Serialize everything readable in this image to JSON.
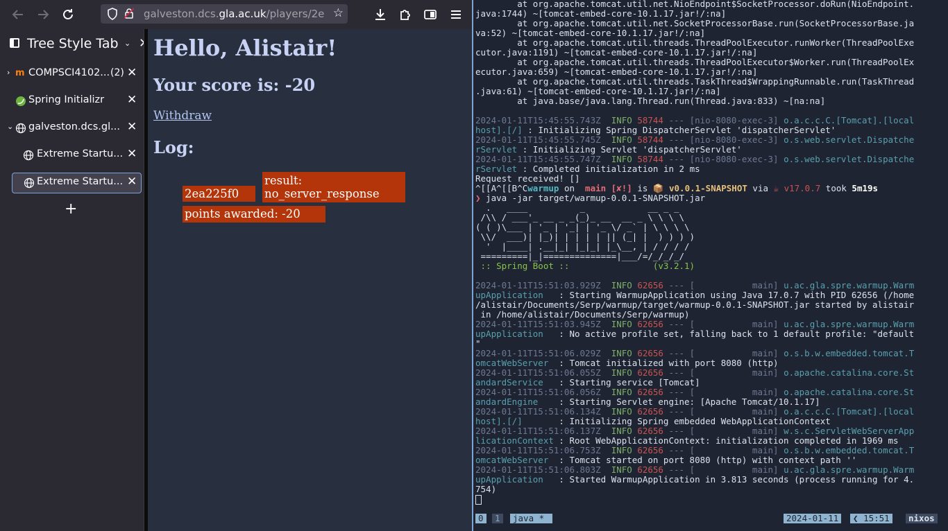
{
  "browser": {
    "url_prefix": "galveston.dcs.",
    "url_domain": "gla.ac.uk",
    "url_suffix": "/players/2e",
    "sidebar_title": "Tree Style Tab",
    "tabs": [
      {
        "label": "COMPSCI4102...",
        "count": "(2)",
        "icon": "moodle-icon",
        "expanded": false
      },
      {
        "label": "Spring Initializr",
        "icon": "spring-icon"
      },
      {
        "label": "galveston.dcs.gl...",
        "icon": "globe-icon",
        "expanded": true
      },
      {
        "label": "Extreme Startu...",
        "icon": "globe-icon"
      },
      {
        "label": "Extreme Startu...",
        "icon": "globe-icon",
        "active": true
      }
    ]
  },
  "page": {
    "greeting": "Hello, Alistair!",
    "score": "Your score is: -20",
    "withdraw": "Withdraw",
    "log_title": "Log:",
    "log": {
      "id": "2ea225f0",
      "result_label": "result:",
      "result_value": "no_server_response",
      "points": "points awarded: -20"
    }
  },
  "terminal": {
    "trace": [
      "        at org.apache.tomcat.util.net.NioEndpoint$SocketProcessor.doRun(NioEndpoint.",
      "java:1744) ~[tomcat-embed-core-10.1.17.jar!/:na]",
      "        at org.apache.tomcat.util.net.SocketProcessorBase.run(SocketProcessorBase.ja",
      "va:52) ~[tomcat-embed-core-10.1.17.jar!/:na]",
      "        at org.apache.tomcat.util.threads.ThreadPoolExecutor.runWorker(ThreadPoolExe",
      "cutor.java:1191) ~[tomcat-embed-core-10.1.17.jar!/:na]",
      "        at org.apache.tomcat.util.threads.ThreadPoolExecutor$Worker.run(ThreadPoolEx",
      "ecutor.java:659) ~[tomcat-embed-core-10.1.17.jar!/:na]",
      "        at org.apache.tomcat.util.threads.TaskThread$WrappingRunnable.run(TaskThread",
      ".java:61) ~[tomcat-embed-core-10.1.17.jar!/:na]",
      "        at java.base/java.lang.Thread.run(Thread.java:833) ~[na:na]"
    ],
    "log_a": [
      {
        "ts": "2024-01-11T15:45:55.743Z",
        "pid": "58744",
        "thread": "[nio-8080-exec-3]",
        "cls1": "o.a.c.c.C.[Tomcat].[local",
        "cls2": "host].[/]",
        "msg": "Initializing Spring DispatcherServlet 'dispatcherServlet'"
      },
      {
        "ts": "2024-01-11T15:45:55.745Z",
        "pid": "58744",
        "thread": "[nio-8080-exec-3]",
        "cls1": "o.s.web.servlet.Dispatche",
        "cls2": "rServlet",
        "msg": "Initializing Servlet 'dispatcherServlet'"
      },
      {
        "ts": "2024-01-11T15:45:55.747Z",
        "pid": "58744",
        "thread": "[nio-8080-exec-3]",
        "cls1": "o.s.web.servlet.Dispatche",
        "cls2": "rServlet",
        "msg": "Completed initialization in 2 ms"
      }
    ],
    "request_line": "Request received! []",
    "prompt": {
      "prefix": "^[[A^[[B^C",
      "dir": "warmup",
      "on": " on ",
      "branch": " main [✘!]",
      "is": " is ",
      "version": "📦 v0.0.1-SNAPSHOT",
      "via": " via ",
      "java": "☕ v17.0.7",
      "took": " took ",
      "time": "5m19s"
    },
    "command": "❯ java -jar target/warmup-0.0.1-SNAPSHOT.jar",
    "banner": [
      "",
      "  .   ____          _            __ _ _",
      " /\\\\ / ___'_ __ _ _(_)_ __  __ _ \\ \\ \\ \\",
      "( ( )\\___ | '_ | '_| | '_ \\/ _` | \\ \\ \\ \\",
      " \\\\/  ___)| |_)| | | | | || (_| |  ) ) ) )",
      "  '  |____| .__|_| |_|_| |_\\__, | / / / /",
      " =========|_|==============|___/=/_/_/_/"
    ],
    "spring_boot": " :: Spring Boot ::                (v3.2.1)",
    "log_b": [
      {
        "ts": "2024-01-11T15:51:03.929Z",
        "pid": "62656",
        "thread": "[           main]",
        "cls1": "u.ac.gla.spre.warmup.Warm",
        "cls2": "upApplication  ",
        "msg": "Starting WarmupApplication using Java 17.0.7 with PID 62656 (/home",
        "more": [
          "/alistair/Documents/Serp/warmup/target/warmup-0.0.1-SNAPSHOT.jar started by alistair",
          " in /home/alistair/Documents/Serp/warmup)"
        ]
      },
      {
        "ts": "2024-01-11T15:51:03.945Z",
        "pid": "62656",
        "thread": "[           main]",
        "cls1": "u.ac.gla.spre.warmup.Warm",
        "cls2": "upApplication  ",
        "msg": "No active profile set, falling back to 1 default profile: \"default",
        "more": [
          "\""
        ]
      },
      {
        "ts": "2024-01-11T15:51:06.029Z",
        "pid": "62656",
        "thread": "[           main]",
        "cls1": "o.s.b.w.embedded.tomcat.T",
        "cls2": "omcatWebServer ",
        "msg": "Tomcat initialized with port 8080 (http)"
      },
      {
        "ts": "2024-01-11T15:51:06.055Z",
        "pid": "62656",
        "thread": "[           main]",
        "cls1": "o.apache.catalina.core.St",
        "cls2": "andardService  ",
        "msg": "Starting service [Tomcat]"
      },
      {
        "ts": "2024-01-11T15:51:06.056Z",
        "pid": "62656",
        "thread": "[           main]",
        "cls1": "o.apache.catalina.core.St",
        "cls2": "andardEngine   ",
        "msg": "Starting Servlet engine: [Apache Tomcat/10.1.17]"
      },
      {
        "ts": "2024-01-11T15:51:06.134Z",
        "pid": "62656",
        "thread": "[           main]",
        "cls1": "o.a.c.c.C.[Tomcat].[local",
        "cls2": "host].[/]      ",
        "msg": "Initializing Spring embedded WebApplicationContext"
      },
      {
        "ts": "2024-01-11T15:51:06.137Z",
        "pid": "62656",
        "thread": "[           main]",
        "cls1": "w.s.c.ServletWebServerApp",
        "cls2": "licationContext",
        "msg": "Root WebApplicationContext: initialization completed in 1969 ms"
      },
      {
        "ts": "2024-01-11T15:51:06.753Z",
        "pid": "62656",
        "thread": "[           main]",
        "cls1": "o.s.b.w.embedded.tomcat.T",
        "cls2": "omcatWebServer ",
        "msg": "Tomcat started on port 8080 (http) with context path ''"
      },
      {
        "ts": "2024-01-11T15:51:06.803Z",
        "pid": "62656",
        "thread": "[           main]",
        "cls1": "u.ac.gla.spre.warmup.Warm",
        "cls2": "upApplication  ",
        "msg": "Started WarmupApplication in 3.813 seconds (process running for 4.",
        "more": [
          "754)"
        ]
      }
    ],
    "status": {
      "session": "0",
      "window_index": "1",
      "window_name": "java *",
      "date": "2024-01-11",
      "time": "15:51",
      "host": "nixos"
    }
  }
}
